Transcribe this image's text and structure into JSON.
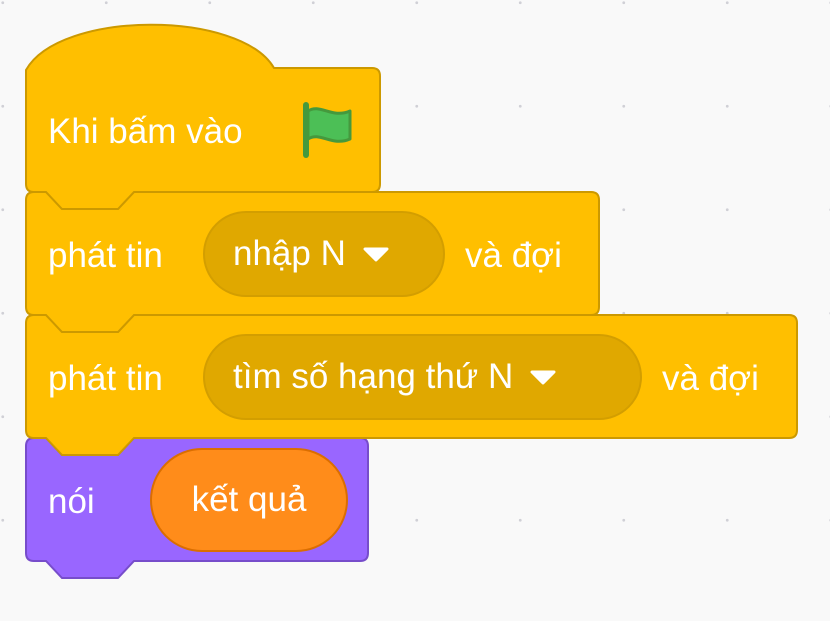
{
  "workspace": {
    "hat_block": {
      "label": "Khi bấm vào",
      "icon": "green-flag-icon",
      "color": "#ffbf00"
    },
    "broadcast_blocks": [
      {
        "label": "phát tin",
        "message": "nhập N",
        "suffix": "và đợi"
      },
      {
        "label": "phát tin",
        "message": "tìm số hạng thứ N",
        "suffix": "và đợi"
      }
    ],
    "say_block": {
      "label": "nói",
      "reporter": "kết quả",
      "color": "#9966ff",
      "reporter_color": "#ff8c1a"
    },
    "colors": {
      "events": "#ffbf00",
      "events_border": "#cc9900",
      "events_dropdown": "#e0a800",
      "looks": "#9966ff",
      "looks_border": "#774dcb",
      "variables": "#ff8c1a",
      "flag_green": "#4cbf56"
    }
  }
}
